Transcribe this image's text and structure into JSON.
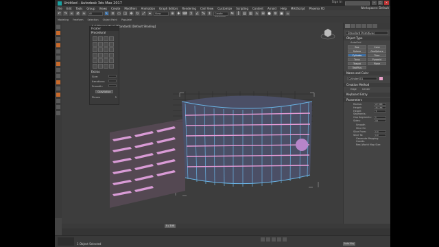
{
  "window": {
    "title": "Untitled - Autodesk 3ds Max 2017",
    "signin": "Sign In",
    "workspace": "Workspaces: Default"
  },
  "menu": [
    "File",
    "Edit",
    "Tools",
    "Group",
    "Views",
    "Create",
    "Modifiers",
    "Animation",
    "Graph Editors",
    "Rendering",
    "Civil View",
    "Customize",
    "Scripting",
    "Content",
    "Arnold",
    "Help",
    "MAXScript",
    "Phoenix FD"
  ],
  "toolbar": {
    "view_dropdown": "View",
    "selection_set": "Create Selection Se"
  },
  "ribbon": [
    "Modeling",
    "Freeform",
    "Selection",
    "Object Paint",
    "Populate"
  ],
  "viewport": {
    "label": "[+] [Perspective] [Standard] [Default Shading]"
  },
  "floater": {
    "title": "Floater",
    "heading": "Procedural",
    "section": "Extras",
    "size_label": "Size:",
    "iterations_label": "Iterations:",
    "smooth_label": "Smooth:",
    "button": "Gravitation",
    "pieces_label": "Pieces",
    "pieces_value": "5"
  },
  "command_panel": {
    "category": "Standard Primitives",
    "object_type_title": "Object Type",
    "autogrid": "AutoGrid",
    "object_types": [
      "Box",
      "Cone",
      "Sphere",
      "GeoSphere",
      "Cylinder",
      "Tube",
      "Torus",
      "Pyramid",
      "Teapot",
      "Plane",
      "TextPlus"
    ],
    "selected_type": "Cylinder",
    "name_color_title": "Name and Color",
    "name_value": "Cylinder001",
    "creation_method_title": "Creation Method",
    "creation_options": [
      "Edge",
      "Center"
    ],
    "keyboard_entry_title": "Keyboard Entry",
    "parameters_title": "Parameters",
    "params": [
      {
        "label": "Radius:",
        "value": "22.368"
      },
      {
        "label": "Height:",
        "value": "45.158"
      },
      {
        "label": "Height Segments:",
        "value": "5"
      },
      {
        "label": "Cap Segments:",
        "value": "1"
      },
      {
        "label": "Sides:",
        "value": "18"
      }
    ],
    "checks": [
      "Smooth",
      "Slice On",
      "Slice From:",
      "Slice To:",
      "Generate Mapping Coords.",
      "Real-World Map Size"
    ],
    "slice_from": "0.0",
    "slice_to": "0.0",
    "swatch_color": "#e8a0c8"
  },
  "timeline": {
    "frame": "0 / 100"
  },
  "status": {
    "selected": "1 Object Selected",
    "autokey": "Auto Key",
    "set_key": "Set Key"
  }
}
